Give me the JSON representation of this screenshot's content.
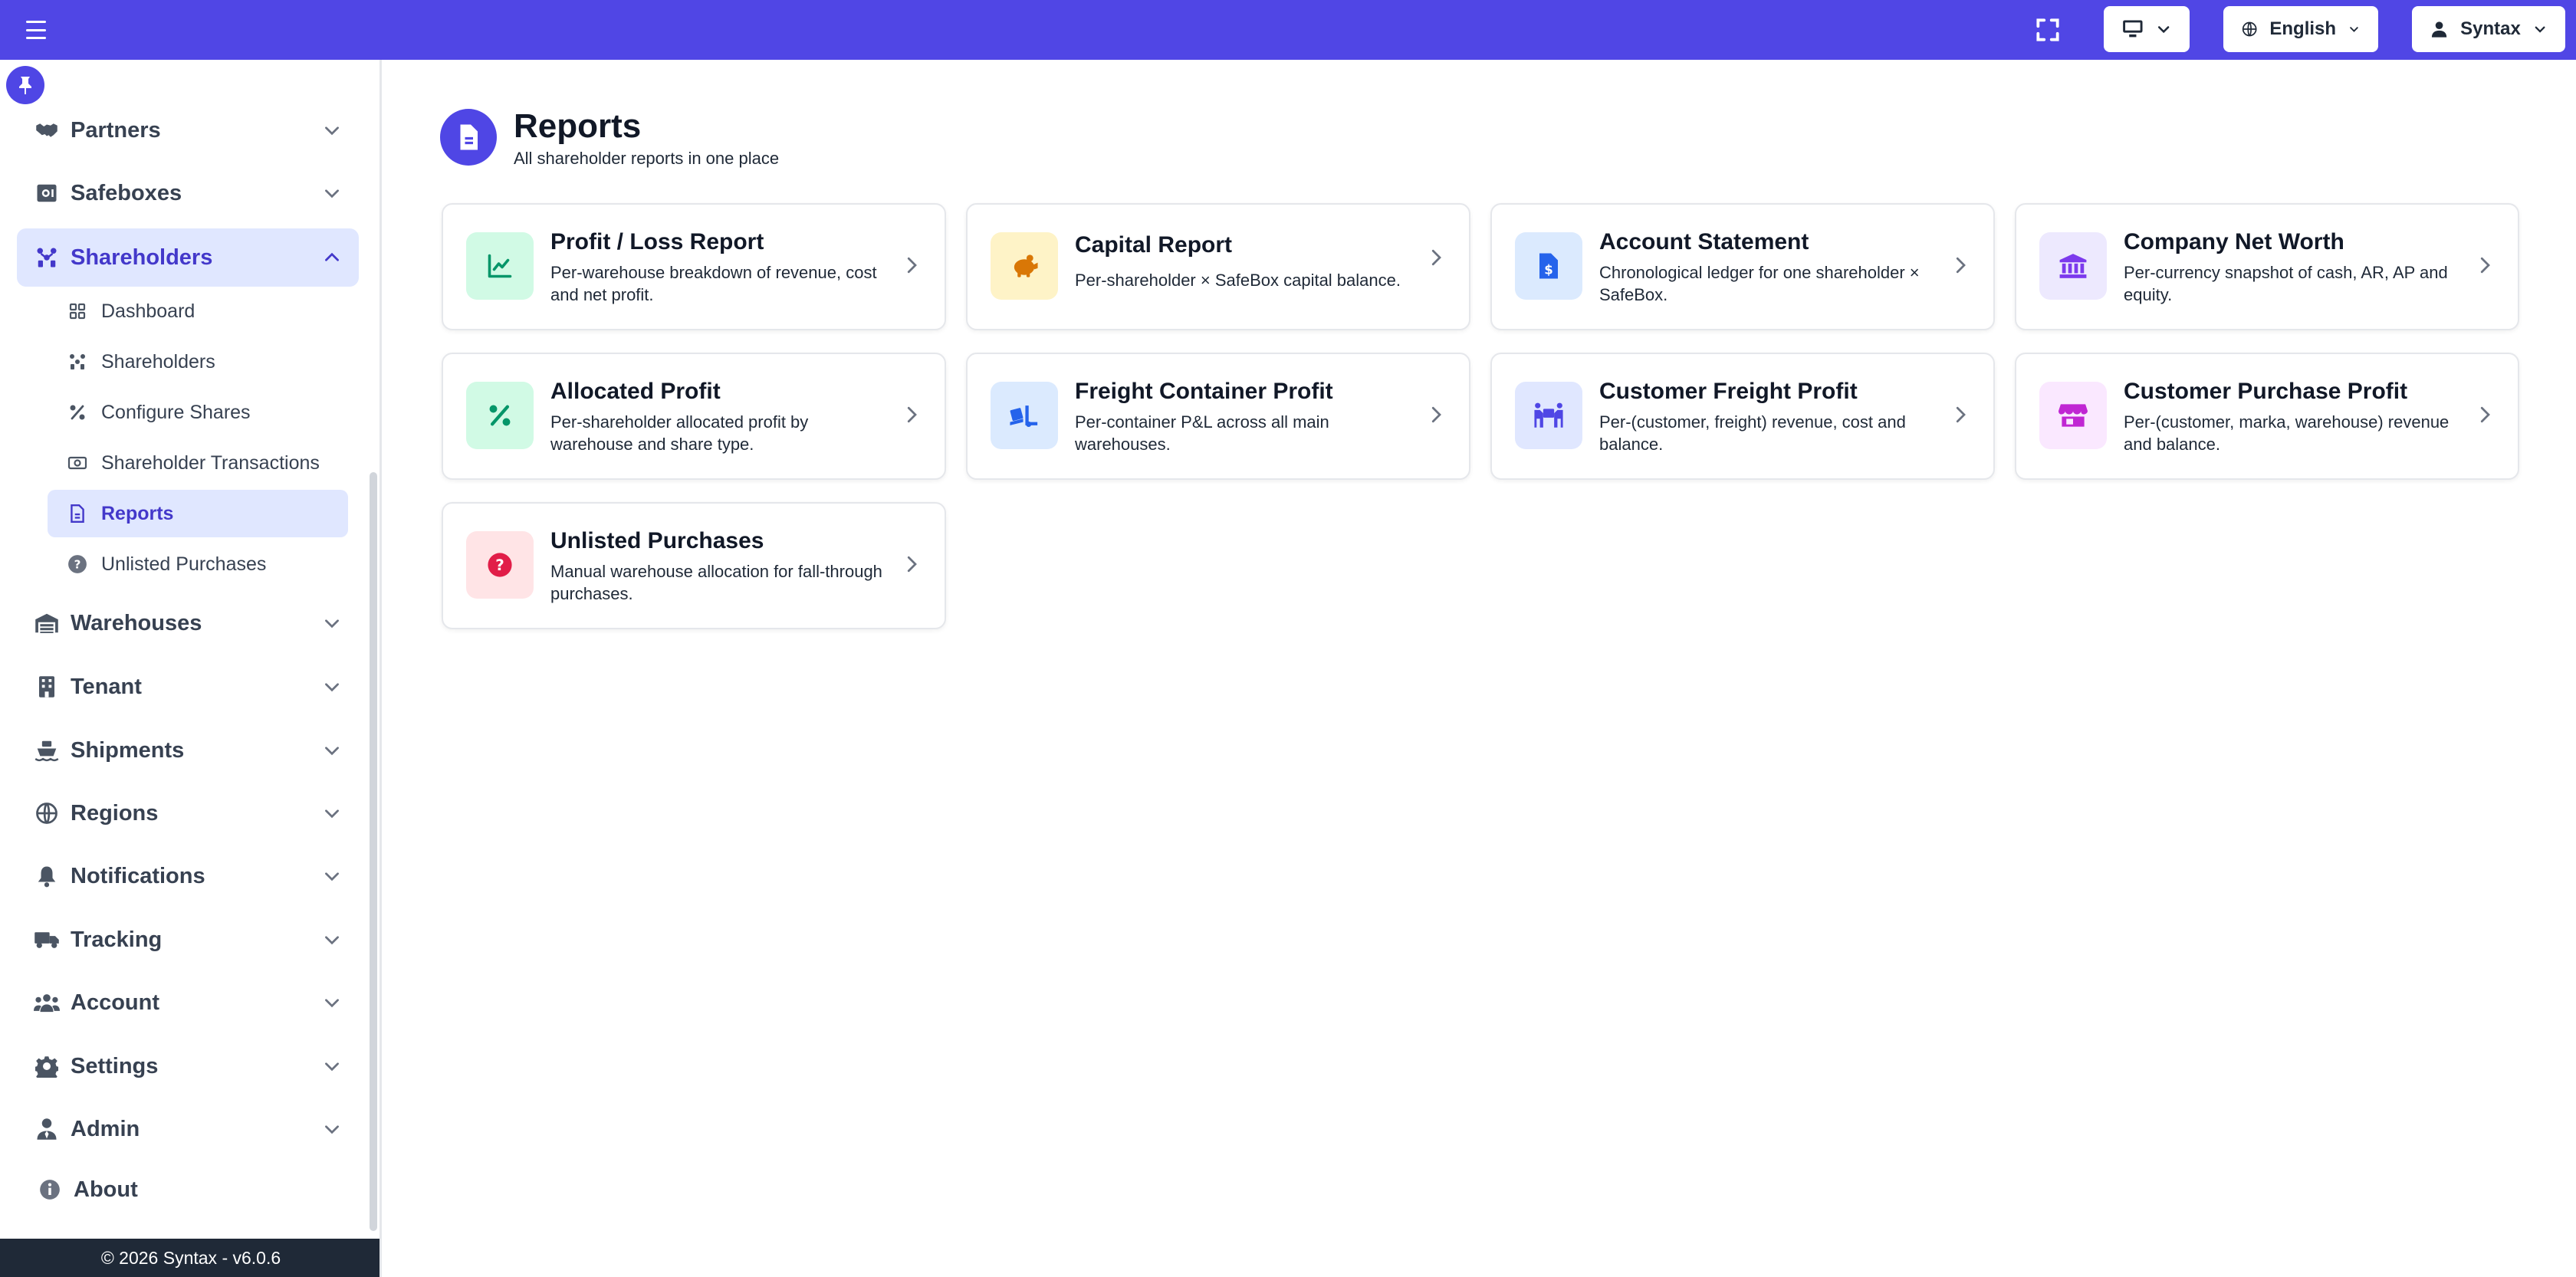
{
  "topbar": {
    "language_label": "English",
    "user_label": "Syntax"
  },
  "sidebar": {
    "items_top": [
      {
        "label": "Partners",
        "icon": "handshake-icon"
      },
      {
        "label": "Safeboxes",
        "icon": "safe-icon"
      },
      {
        "label": "Shareholders",
        "icon": "users-network-icon",
        "expanded": true
      }
    ],
    "sub_items": [
      {
        "label": "Dashboard",
        "icon": "grid-icon"
      },
      {
        "label": "Shareholders",
        "icon": "users-network-icon"
      },
      {
        "label": "Configure Shares",
        "icon": "percent-icon"
      },
      {
        "label": "Shareholder Transactions",
        "icon": "money-icon"
      },
      {
        "label": "Reports",
        "icon": "file-icon",
        "active": true
      },
      {
        "label": "Unlisted Purchases",
        "icon": "question-icon"
      }
    ],
    "items_bottom": [
      {
        "label": "Warehouses",
        "icon": "warehouse-icon"
      },
      {
        "label": "Tenant",
        "icon": "building-icon"
      },
      {
        "label": "Shipments",
        "icon": "ship-icon"
      },
      {
        "label": "Regions",
        "icon": "globe-icon"
      },
      {
        "label": "Notifications",
        "icon": "bell-icon"
      },
      {
        "label": "Tracking",
        "icon": "truck-icon"
      },
      {
        "label": "Account",
        "icon": "users-icon"
      },
      {
        "label": "Settings",
        "icon": "gear-icon"
      },
      {
        "label": "Admin",
        "icon": "user-tie-icon"
      },
      {
        "label": "About",
        "icon": "info-icon"
      }
    ],
    "footer": "© 2026 Syntax - v6.0.6"
  },
  "page": {
    "title": "Reports",
    "subtitle": "All shareholder reports in one place"
  },
  "cards": [
    {
      "title": "Profit / Loss Report",
      "description": "Per-warehouse breakdown of revenue, cost and net profit.",
      "icon": "chart-line-icon",
      "bg": "#d1fae5",
      "fg": "#059669"
    },
    {
      "title": "Capital Report",
      "description": "Per-shareholder × SafeBox capital balance.",
      "icon": "piggy-bank-icon",
      "bg": "#fef3c7",
      "fg": "#d97706"
    },
    {
      "title": "Account Statement",
      "description": "Chronological ledger for one shareholder × SafeBox.",
      "icon": "file-invoice-dollar-icon",
      "bg": "#dbeafe",
      "fg": "#2563eb"
    },
    {
      "title": "Company Net Worth",
      "description": "Per-currency snapshot of cash, AR, AP and equity.",
      "icon": "bank-icon",
      "bg": "#ede9fe",
      "fg": "#7c3aed"
    },
    {
      "title": "Allocated Profit",
      "description": "Per-shareholder allocated profit by warehouse and share type.",
      "icon": "percent-icon",
      "bg": "#d1fae5",
      "fg": "#059669"
    },
    {
      "title": "Freight Container Profit",
      "description": "Per-container P&L across all main warehouses.",
      "icon": "truck-ramp-icon",
      "bg": "#dbeafe",
      "fg": "#2563eb"
    },
    {
      "title": "Customer Freight Profit",
      "description": "Per-(customer, freight) revenue, cost and balance.",
      "icon": "people-carry-icon",
      "bg": "#e0e7ff",
      "fg": "#4f46e5"
    },
    {
      "title": "Customer Purchase Profit",
      "description": "Per-(customer, marka, warehouse) revenue and balance.",
      "icon": "shop-icon",
      "bg": "#fae8ff",
      "fg": "#c026d3"
    },
    {
      "title": "Unlisted Purchases",
      "description": "Manual warehouse allocation for fall-through purchases.",
      "icon": "question-circle-icon",
      "bg": "#ffe4e6",
      "fg": "#e11d48"
    }
  ]
}
